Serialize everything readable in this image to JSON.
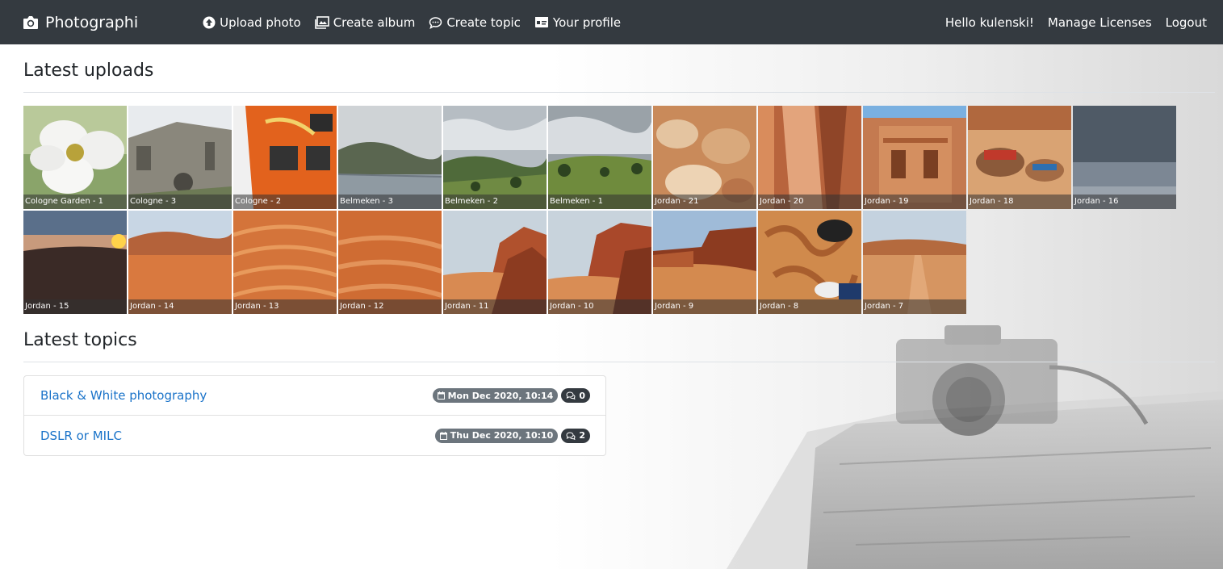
{
  "nav": {
    "brand": "Photographi",
    "links": [
      {
        "label": "Upload photo",
        "icon": "upload-icon"
      },
      {
        "label": "Create album",
        "icon": "images-icon"
      },
      {
        "label": "Create topic",
        "icon": "chat-icon"
      },
      {
        "label": "Your profile",
        "icon": "id-card-icon"
      }
    ],
    "greeting": "Hello kulenski!",
    "manage": "Manage Licenses",
    "logout": "Logout"
  },
  "uploads": {
    "title": "Latest uploads",
    "photos": [
      {
        "caption": "Cologne Garden - 1",
        "theme": "flower"
      },
      {
        "caption": "Cologne - 3",
        "theme": "church"
      },
      {
        "caption": "Cologne - 2",
        "theme": "orange-building"
      },
      {
        "caption": "Belmeken - 3",
        "theme": "lake"
      },
      {
        "caption": "Belmeken - 2",
        "theme": "valley"
      },
      {
        "caption": "Belmeken - 1",
        "theme": "meadow"
      },
      {
        "caption": "Jordan - 21",
        "theme": "rock-texture"
      },
      {
        "caption": "Jordan - 20",
        "theme": "canyon"
      },
      {
        "caption": "Jordan - 19",
        "theme": "tomb"
      },
      {
        "caption": "Jordan - 18",
        "theme": "camels"
      },
      {
        "caption": "Jordan - 16",
        "theme": "sky"
      },
      {
        "caption": "Jordan - 15",
        "theme": "sunset"
      },
      {
        "caption": "Jordan - 14",
        "theme": "desert"
      },
      {
        "caption": "Jordan - 13",
        "theme": "sand"
      },
      {
        "caption": "Jordan - 12",
        "theme": "sand2"
      },
      {
        "caption": "Jordan - 11",
        "theme": "cliff"
      },
      {
        "caption": "Jordan - 10",
        "theme": "cliff2"
      },
      {
        "caption": "Jordan - 9",
        "theme": "desert2"
      },
      {
        "caption": "Jordan - 8",
        "theme": "footprints"
      },
      {
        "caption": "Jordan - 7",
        "theme": "road"
      }
    ]
  },
  "topics": {
    "title": "Latest topics",
    "items": [
      {
        "title": "Black & White photography",
        "date": "Mon Dec 2020, 10:14",
        "count": "0"
      },
      {
        "title": "DSLR or MILC",
        "date": "Thu Dec 2020, 10:10",
        "count": "2"
      }
    ]
  },
  "colors": {
    "navbar": "#343a40",
    "link": "#1a73c9",
    "badge_date": "#6c757d",
    "badge_count": "#343a40"
  }
}
